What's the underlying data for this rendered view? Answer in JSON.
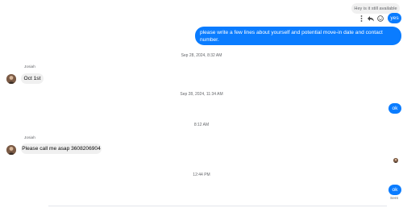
{
  "conversation": {
    "replied_to": "Hey is it still available",
    "yes_label": "yes",
    "prompt_message": "please write a few lines about yourself and potential move-in date  and contact number.",
    "stamp_1": "Sep 28, 2024, 8:32 AM",
    "sender_name_1": "Josiah",
    "reply_1": "Oct 1st",
    "stamp_2": "Sep 28, 2024, 11:34 AM",
    "ok_1": "ok",
    "stamp_3": "8:12 AM",
    "sender_name_2": "Josiah",
    "reply_2": "Please call me asap 3608206904",
    "stamp_4": "12:44 PM",
    "ok_2": "ok",
    "status": "Sent"
  },
  "colors": {
    "outgoing": "#0a7cff",
    "incoming": "#f0f0f0",
    "timestamp": "#65676b"
  },
  "icons": [
    "more-vertical-icon",
    "reply-icon",
    "emoji-icon",
    "avatar-icon"
  ]
}
